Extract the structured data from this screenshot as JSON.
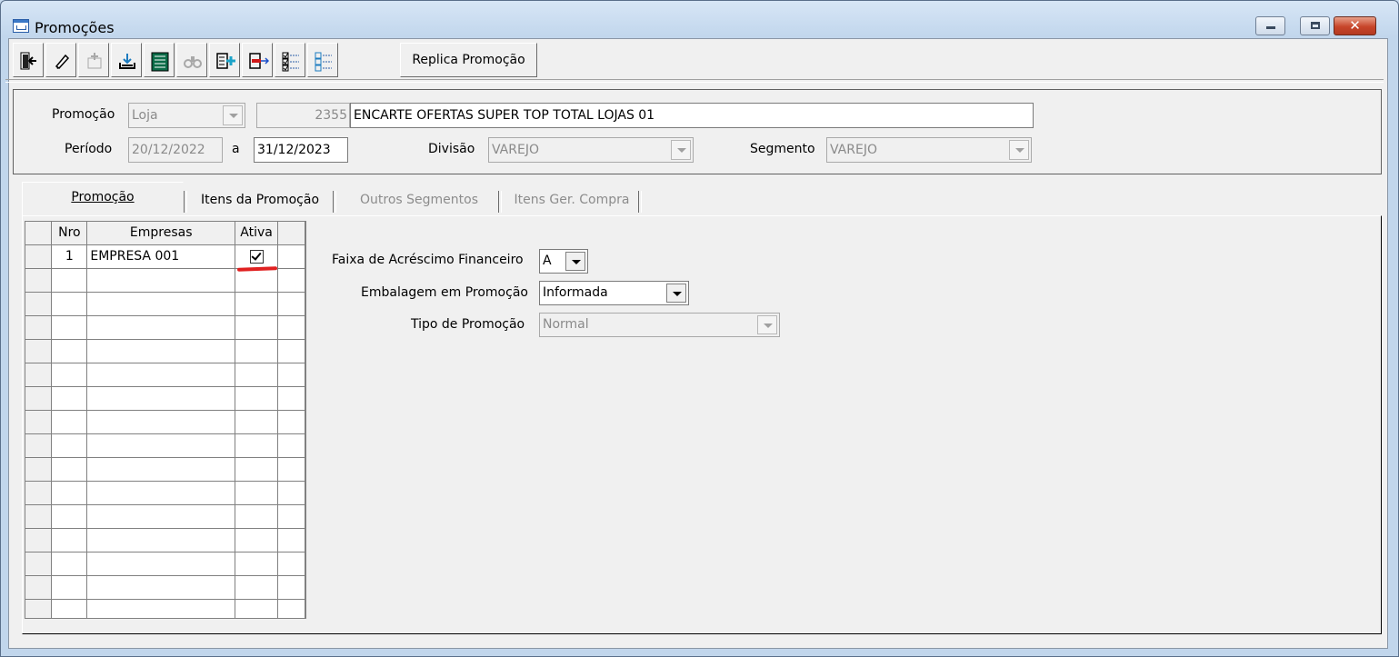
{
  "window": {
    "title": "Promoções",
    "controls": {
      "minimize": "minimize-icon",
      "maximize": "maximize-icon",
      "close": "✕"
    }
  },
  "toolbar": {
    "icons": [
      "exit-door-icon",
      "eraser-icon",
      "add-document-icon",
      "save-tray-icon",
      "list-view-icon",
      "binoculars-search-icon",
      "insert-plus-icon",
      "export-arrow-icon",
      "checklist-icon",
      "uncheck-list-icon"
    ],
    "replica_label": "Replica Promoção"
  },
  "header": {
    "promocao_label": "Promoção",
    "promocao_type": "Loja",
    "promocao_number": "2355",
    "promocao_description": "ENCARTE OFERTAS SUPER TOP TOTAL LOJAS 01",
    "periodo_label": "Período",
    "periodo_start": "20/12/2022",
    "periodo_sep": "a",
    "periodo_end": "31/12/2023",
    "divisao_label": "Divisão",
    "divisao_value": "VAREJO",
    "segmento_label": "Segmento",
    "segmento_value": "VAREJO"
  },
  "tabs": [
    {
      "label": "Promoção",
      "state": "active"
    },
    {
      "label": "Itens da Promoção",
      "state": "enabled"
    },
    {
      "label": "Outros Segmentos",
      "state": "disabled"
    },
    {
      "label": "Itens Ger. Compra",
      "state": "disabled"
    }
  ],
  "grid": {
    "columns": [
      "Nro",
      "Empresas",
      "Ativa"
    ],
    "rows": [
      {
        "nro": "1",
        "empresa": "EMPRESA 001",
        "ativa": true
      }
    ]
  },
  "form": {
    "faixa_label": "Faixa de Acréscimo Financeiro",
    "faixa_value": "A",
    "embalagem_label": "Embalagem em Promoção",
    "embalagem_value": "Informada",
    "tipo_label": "Tipo de Promoção",
    "tipo_value": "Normal"
  },
  "colors": {
    "accent_underline": "#e02020",
    "title_bar": "#c1d6ec",
    "close_button": "#c7452a"
  }
}
